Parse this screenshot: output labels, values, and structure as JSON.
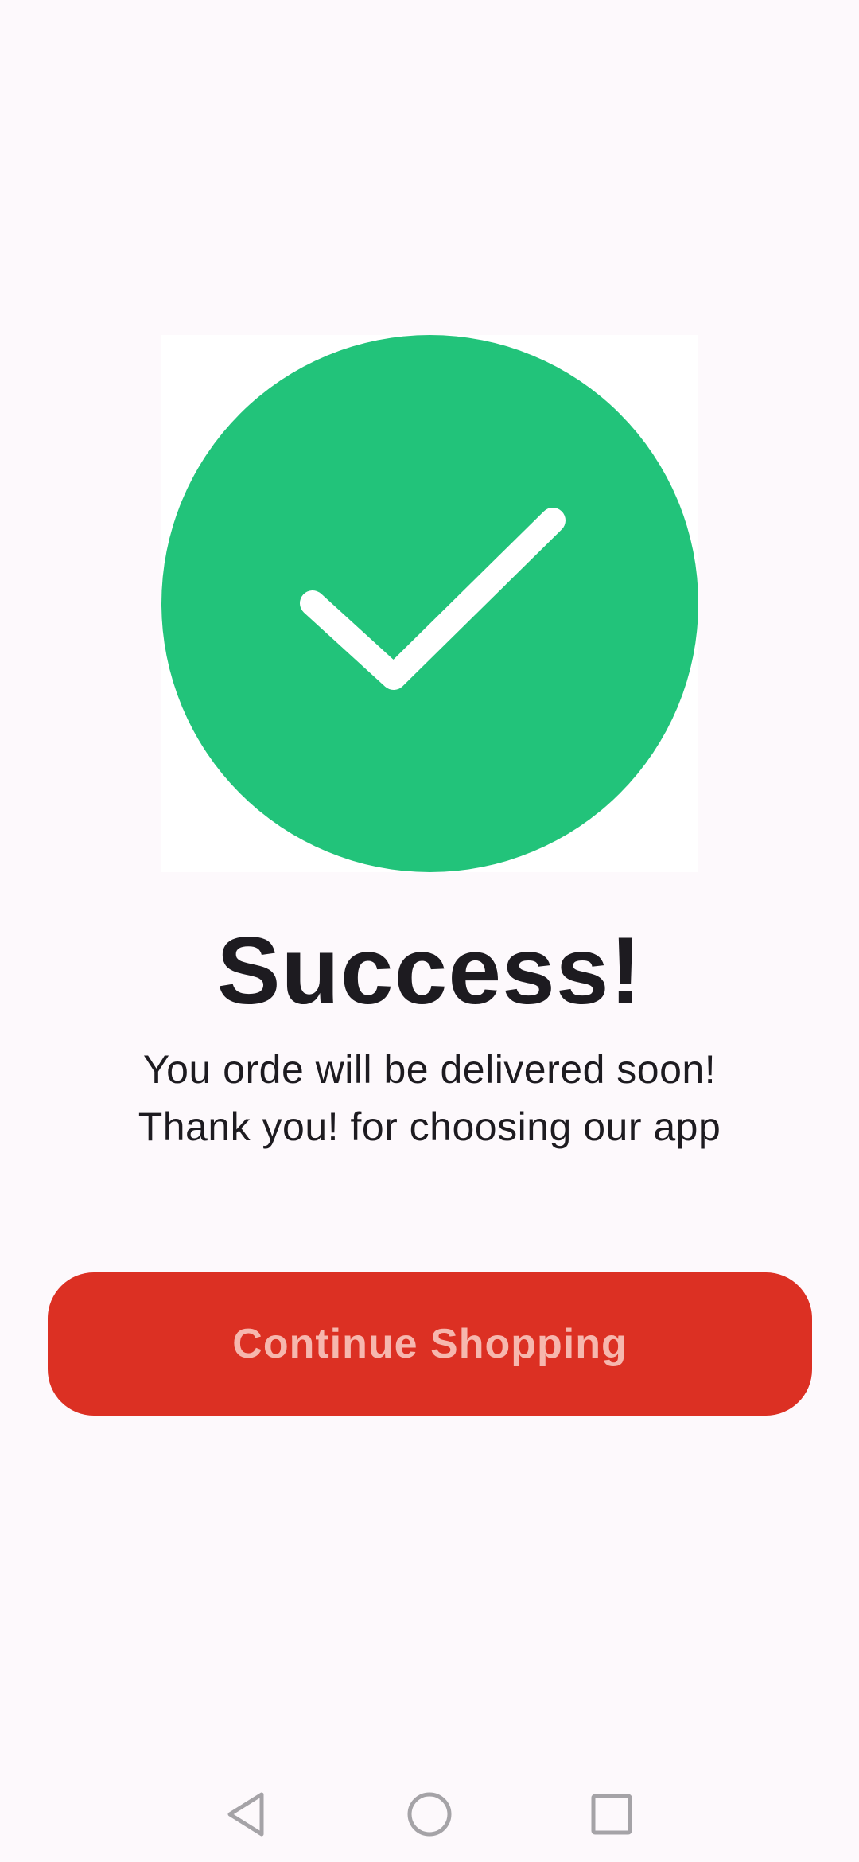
{
  "theme": {
    "background": "#fdf9fc",
    "accent": "#dc3023",
    "button_text": "#f6b7ae",
    "success_green": "#22c37a",
    "nav_icon": "#a5a3a7"
  },
  "success": {
    "icon": "check-circle-icon",
    "title": "Success!",
    "message_line1": "You orde will be delivered soon!",
    "message_line2": "Thank you! for choosing our app"
  },
  "actions": {
    "continue_label": "Continue Shopping"
  },
  "system_nav": {
    "back_icon": "back-triangle-icon",
    "home_icon": "home-circle-icon",
    "recents_icon": "recents-square-icon"
  }
}
